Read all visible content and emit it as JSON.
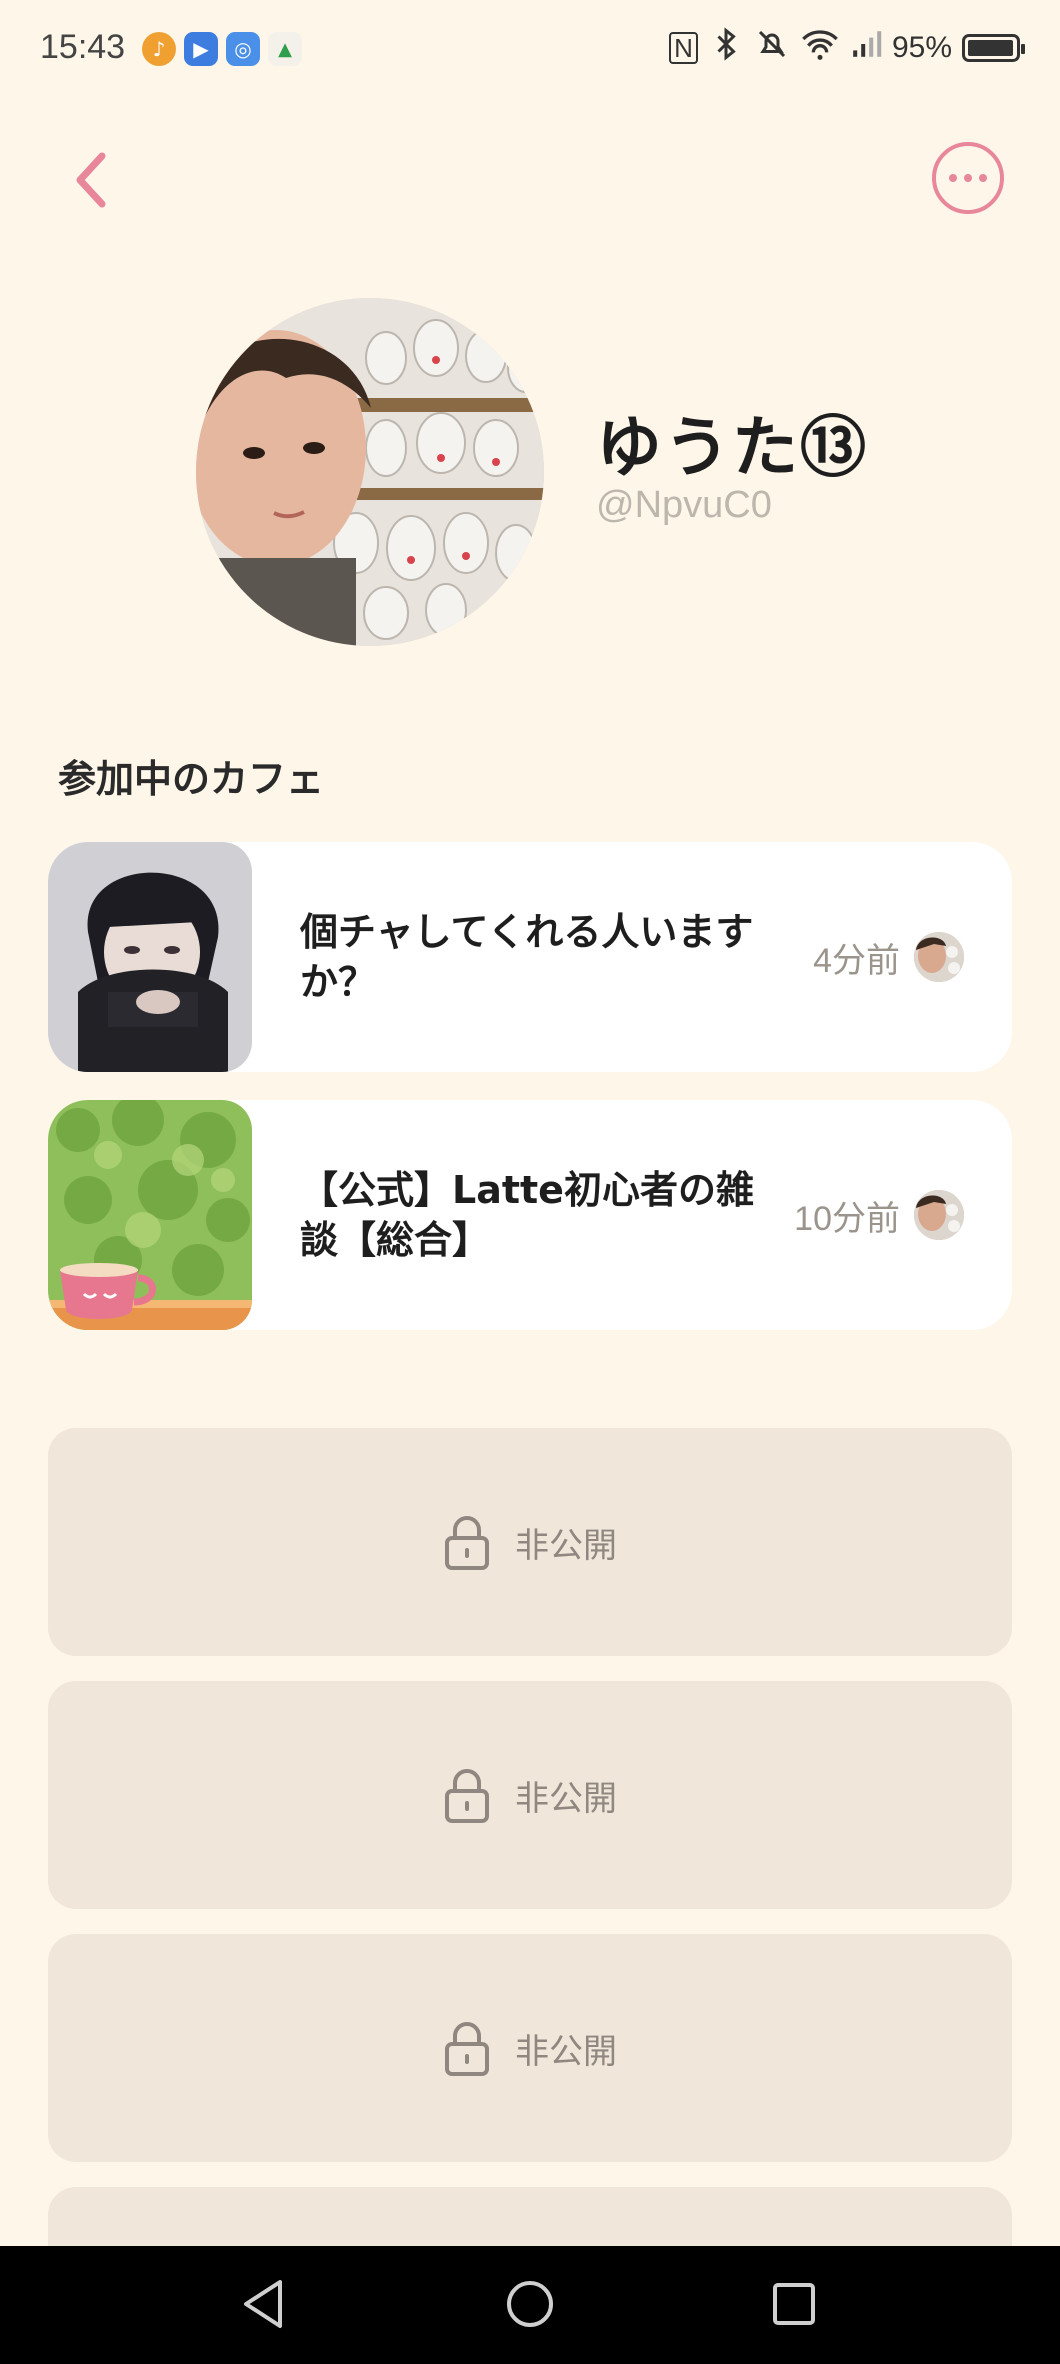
{
  "status_bar": {
    "time": "15:43",
    "battery": "95%",
    "apps": [
      "music-app-icon",
      "youtube-app-icon",
      "chrome-app-icon",
      "keep-app-icon"
    ]
  },
  "header": {
    "back_icon": "chevron-left-icon",
    "more_icon": "more-horizontal-icon"
  },
  "profile": {
    "name": "ゆうた⑬",
    "handle": "@NpvuC0"
  },
  "section": {
    "title": "参加中のカフェ"
  },
  "cafes": [
    {
      "title": "個チャしてくれる人いますか？",
      "time": "4分前"
    },
    {
      "title": "【公式】Latte初心者の雑談【総合】",
      "time": "10分前"
    }
  ],
  "private_items": [
    {
      "label": "非公開"
    },
    {
      "label": "非公開"
    },
    {
      "label": "非公開"
    }
  ],
  "colors": {
    "background": "#fdf6e9",
    "accent": "#e8869a",
    "private_card": "#f0e7da"
  }
}
